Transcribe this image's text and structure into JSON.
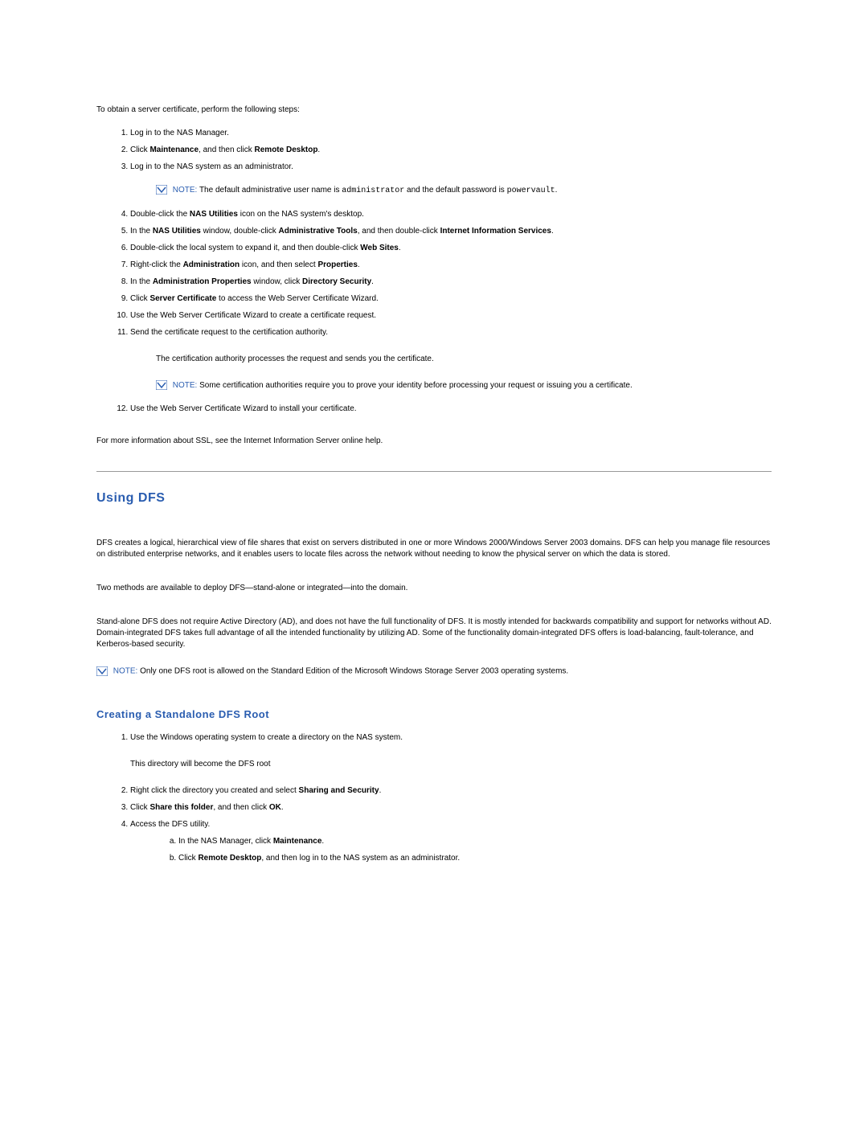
{
  "intro": "To obtain a server certificate, perform the following steps:",
  "steps": {
    "s1": "Log in to the NAS Manager.",
    "s2_a": "Click ",
    "s2_b": "Maintenance",
    "s2_c": ", and then click ",
    "s2_d": "Remote Desktop",
    "s2_e": ".",
    "s3": "Log in to the NAS system as an administrator.",
    "note1_label": "NOTE: ",
    "note1_a": "The default administrative user name is ",
    "note1_b": "administrator",
    "note1_c": " and the default password is ",
    "note1_d": "powervault",
    "note1_e": ".",
    "s4_a": "Double-click the ",
    "s4_b": "NAS Utilities",
    "s4_c": " icon on the NAS system's desktop.",
    "s5_a": "In the ",
    "s5_b": "NAS Utilities",
    "s5_c": " window, double-click ",
    "s5_d": "Administrative Tools",
    "s5_e": ", and then double-click ",
    "s5_f": "Internet Information Services",
    "s5_g": ".",
    "s6_a": "Double-click the local system to expand it, and then double-click ",
    "s6_b": "Web Sites",
    "s6_c": ".",
    "s7_a": "Right-click the ",
    "s7_b": "Administration",
    "s7_c": " icon, and then select ",
    "s7_d": "Properties",
    "s7_e": ".",
    "s8_a": "In the ",
    "s8_b": "Administration Properties",
    "s8_c": " window, click ",
    "s8_d": "Directory Security",
    "s8_e": ".",
    "s9_a": "Click ",
    "s9_b": "Server Certificate",
    "s9_c": " to access the Web Server Certificate Wizard.",
    "s10": "Use the Web Server Certificate Wizard to create a certificate request.",
    "s11": "Send the certificate request to the certification authority.",
    "post11": "The certification authority processes the request and sends you the certificate.",
    "note2_label": "NOTE: ",
    "note2_text": "Some certification authorities require you to prove your identity before processing your request or issuing you a certificate.",
    "s12": "Use the Web Server Certificate Wizard to install your certificate."
  },
  "ssl_more": "For more information about SSL, see the Internet Information Server online help.",
  "dfs": {
    "heading": "Using DFS",
    "p1": "DFS creates a logical, hierarchical view of file shares that exist on servers distributed in one or more Windows 2000/Windows Server 2003 domains. DFS can help you manage file resources on distributed enterprise networks, and it enables users to locate files across the network without needing to know the physical server on which the data is stored.",
    "p2": "Two methods are available to deploy DFS—stand-alone or integrated—into the domain.",
    "p3": "Stand-alone DFS does not require Active Directory (AD), and does not have the full functionality of DFS. It is mostly intended for backwards compatibility and support for networks without AD. Domain-integrated DFS takes full advantage of all the intended functionality by utilizing AD. Some of the functionality domain-integrated DFS offers is load-balancing, fault-tolerance, and Kerberos-based security.",
    "note_label": "NOTE: ",
    "note_text": "Only one DFS root is allowed on the Standard Edition of the Microsoft Windows Storage Server 2003 operating systems.",
    "sub_heading": "Creating a Standalone DFS Root",
    "r1": "Use the Windows operating system to create a directory on the NAS system.",
    "r1_post": "This directory will become the DFS root",
    "r2_a": "Right click the directory you created and select ",
    "r2_b": "Sharing and Security",
    "r2_c": ".",
    "r3_a": "Click ",
    "r3_b": "Share this folder",
    "r3_c": ", and then click ",
    "r3_d": "OK",
    "r3_e": ".",
    "r4": "Access the DFS utility.",
    "r4a_a": "In the NAS Manager, click ",
    "r4a_b": "Maintenance",
    "r4a_c": ".",
    "r4b_a": "Click ",
    "r4b_b": "Remote Desktop",
    "r4b_c": ", and then log in to the NAS system as an administrator."
  }
}
